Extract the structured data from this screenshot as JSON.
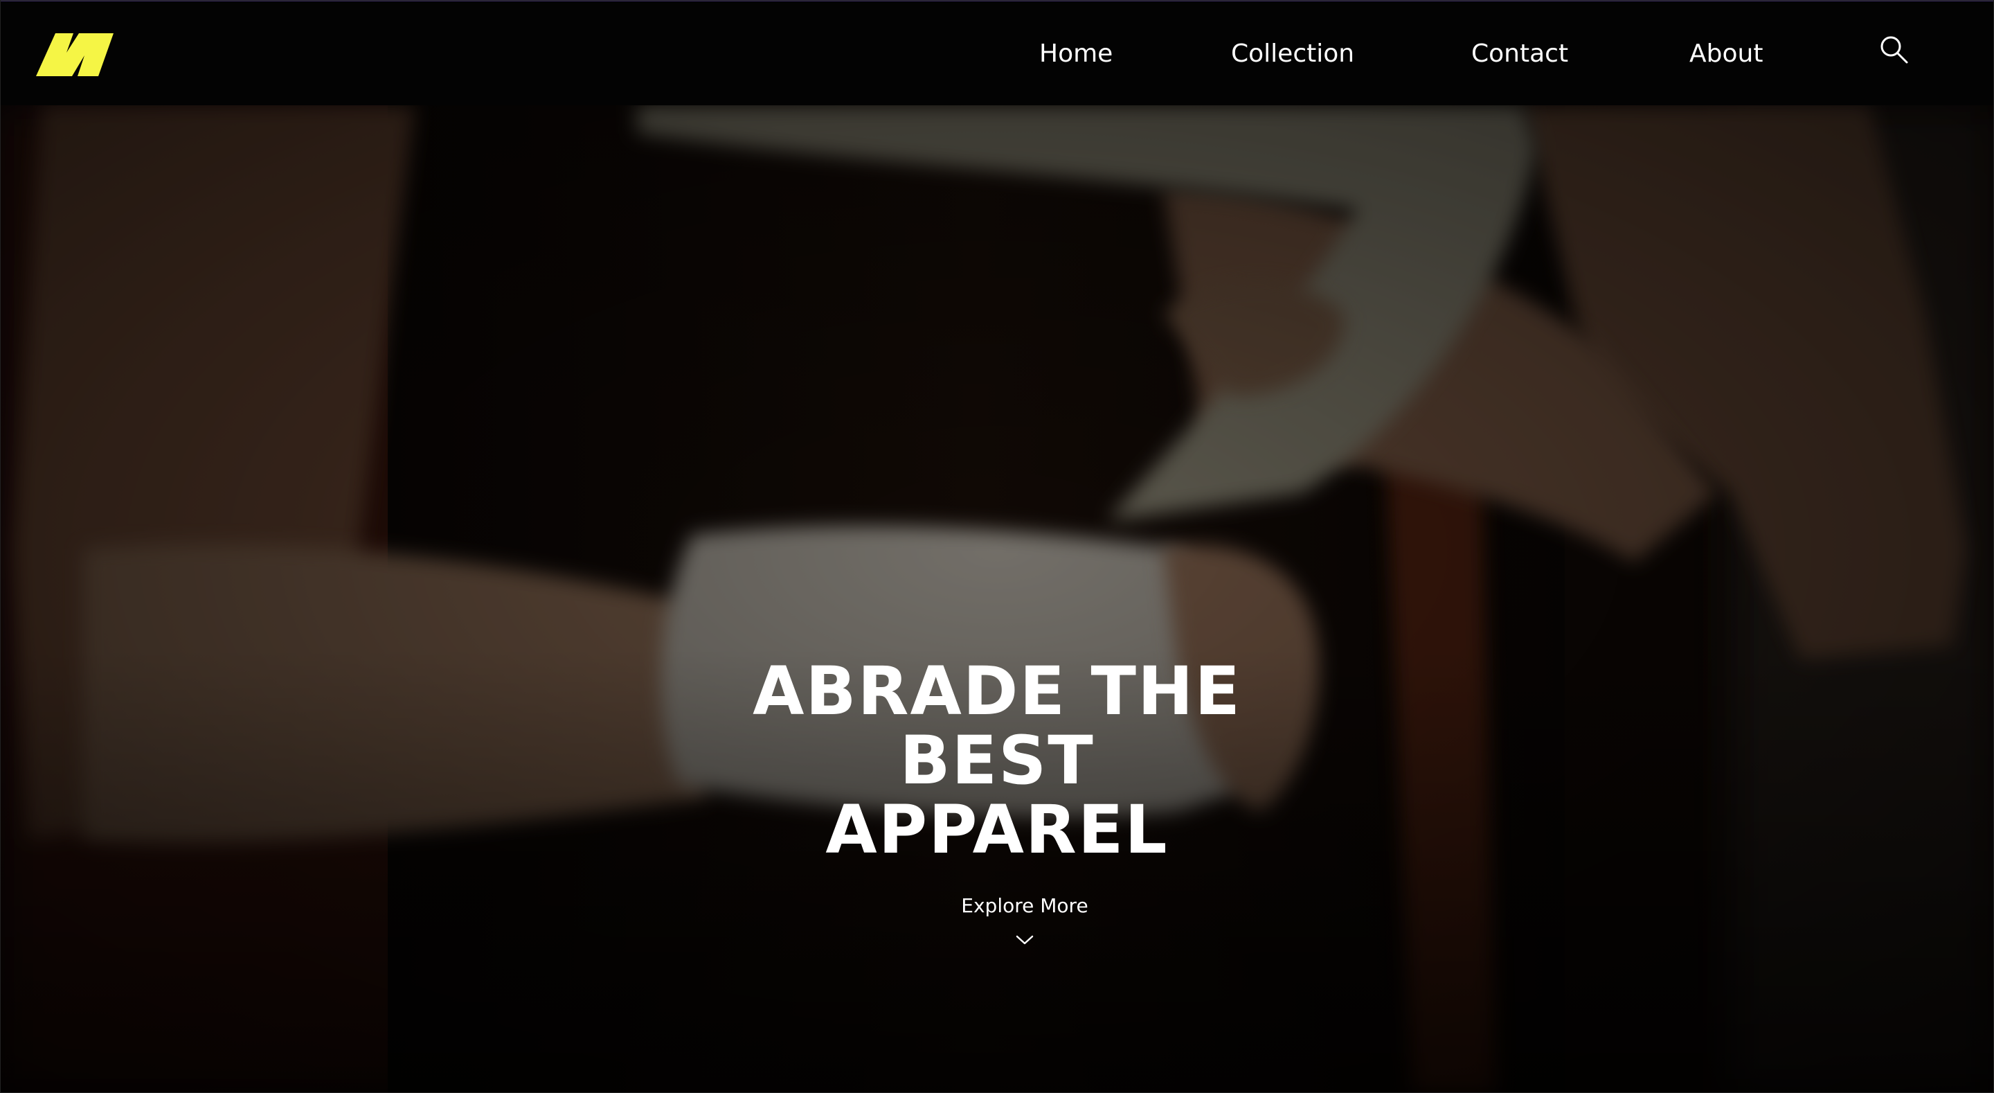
{
  "brand": {
    "logo_icon": "brand-logo-icon",
    "accent_color": "#f5f545"
  },
  "nav": {
    "items": [
      {
        "label": "Home"
      },
      {
        "label": "Collection"
      },
      {
        "label": "Contact"
      },
      {
        "label": "About"
      }
    ],
    "search_icon": "search-icon"
  },
  "hero": {
    "headline_lines": [
      "ABRADE THE",
      "BEST",
      "APPAREL"
    ],
    "cta_label": "Explore More",
    "cta_icon": "chevron-down-icon"
  }
}
